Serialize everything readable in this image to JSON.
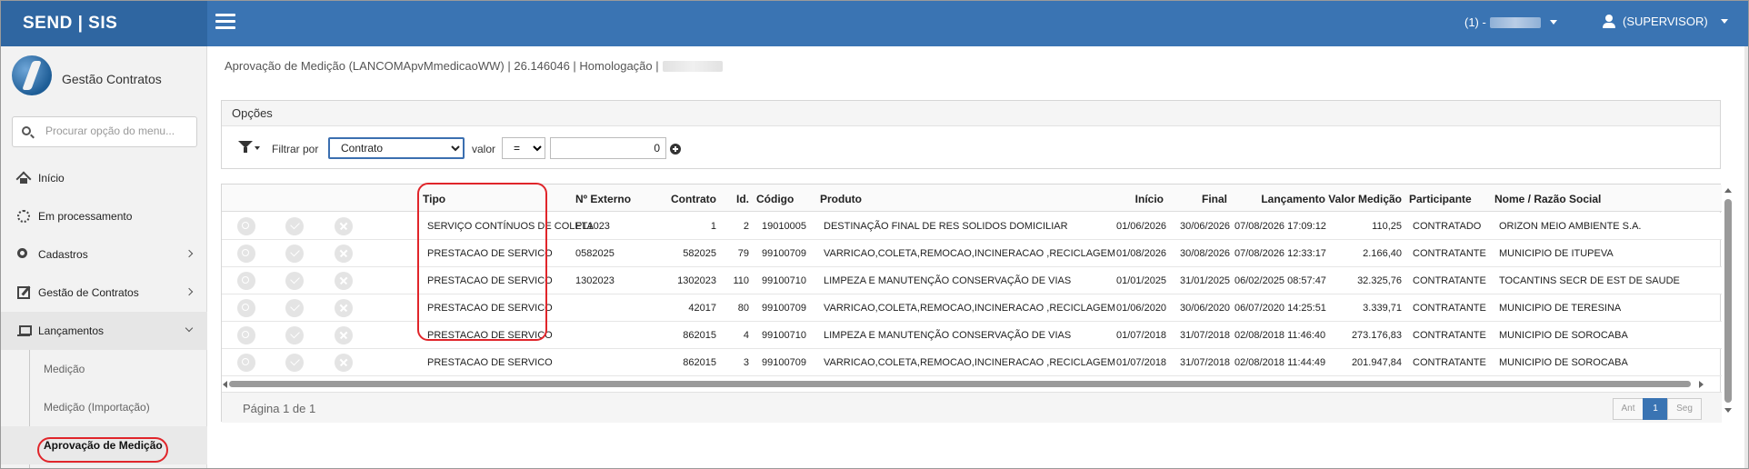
{
  "app": {
    "brand": "SEND | SIS",
    "module": "Gestão Contratos"
  },
  "header": {
    "env_label": "(1) -",
    "user": "(SUPERVISOR)"
  },
  "sidebar": {
    "search_placeholder": "Procurar opção do menu...",
    "items": [
      {
        "label": "Início",
        "icon": "home-icon"
      },
      {
        "label": "Em processamento",
        "icon": "spinner-icon"
      },
      {
        "label": "Cadastros",
        "icon": "gears-icon"
      },
      {
        "label": "Gestão de Contratos",
        "icon": "edit-icon"
      },
      {
        "label": "Lançamentos",
        "icon": "laptop-icon"
      }
    ],
    "subitems": [
      {
        "label": "Medição"
      },
      {
        "label": "Medição (Importação)"
      },
      {
        "label": "Aprovação de Medição"
      }
    ]
  },
  "breadcrumb": {
    "text": "Aprovação de Medição (LANCOMApvMmedicaoWW) | 26.146046 | Homologação |"
  },
  "options": {
    "title": "Opções",
    "filter_label": "Filtrar por",
    "filter_field": "Contrato",
    "value_label": "valor",
    "operator": "=",
    "value": "0"
  },
  "grid": {
    "columns": [
      "Tipo",
      "Nº Externo",
      "Contrato",
      "Id.",
      "Código",
      "Produto",
      "Início",
      "Final",
      "Lançamento",
      "Valor Medição",
      "Participante",
      "Nome / Razão Social"
    ],
    "rows": [
      [
        "SERVIÇO CONTÍNUOS DE COLETA",
        "PL1023",
        "1",
        "2",
        "19010005",
        "DESTINAÇÃO FINAL DE RES SOLIDOS DOMICILIAR",
        "01/06/2026",
        "30/06/2026",
        "07/08/2026 17:09:12",
        "110,25",
        "CONTRATADO",
        "ORIZON MEIO AMBIENTE S.A."
      ],
      [
        "PRESTACAO DE SERVICO",
        "0582025",
        "582025",
        "79",
        "99100709",
        "VARRICAO,COLETA,REMOCAO,INCINERACAO ,RECICLAGEM",
        "01/08/2026",
        "30/08/2026",
        "07/08/2026 12:33:17",
        "2.166,40",
        "CONTRATANTE",
        "MUNICIPIO DE ITUPEVA"
      ],
      [
        "PRESTACAO DE SERVICO",
        "1302023",
        "1302023",
        "110",
        "99100710",
        "LIMPEZA E MANUTENÇÃO CONSERVAÇÃO DE VIAS",
        "01/01/2025",
        "31/01/2025",
        "06/02/2025 08:57:47",
        "32.325,76",
        "CONTRATANTE",
        "TOCANTINS SECR DE EST DE SAUDE"
      ],
      [
        "PRESTACAO DE SERVICO",
        "",
        "42017",
        "80",
        "99100709",
        "VARRICAO,COLETA,REMOCAO,INCINERACAO ,RECICLAGEM",
        "01/06/2020",
        "30/06/2020",
        "06/07/2020 14:25:51",
        "3.339,71",
        "CONTRATANTE",
        "MUNICIPIO DE TERESINA"
      ],
      [
        "PRESTACAO DE SERVICO",
        "",
        "862015",
        "4",
        "99100710",
        "LIMPEZA E MANUTENÇÃO CONSERVAÇÃO DE VIAS",
        "01/07/2018",
        "31/07/2018",
        "02/08/2018 11:46:40",
        "273.176,83",
        "CONTRATANTE",
        "MUNICIPIO DE SOROCABA"
      ],
      [
        "PRESTACAO DE SERVICO",
        "",
        "862015",
        "3",
        "99100709",
        "VARRICAO,COLETA,REMOCAO,INCINERACAO ,RECICLAGEM",
        "01/07/2018",
        "31/07/2018",
        "02/08/2018 11:44:49",
        "201.947,84",
        "CONTRATANTE",
        "MUNICIPIO DE SOROCABA"
      ]
    ]
  },
  "pagination": {
    "info": "Página 1 de 1",
    "prev": "Ant",
    "current": "1",
    "next": "Seg"
  },
  "colors": {
    "topbar": "#3a74b3",
    "brand_bg": "#2f66a1",
    "highlight": "#e0252a"
  }
}
